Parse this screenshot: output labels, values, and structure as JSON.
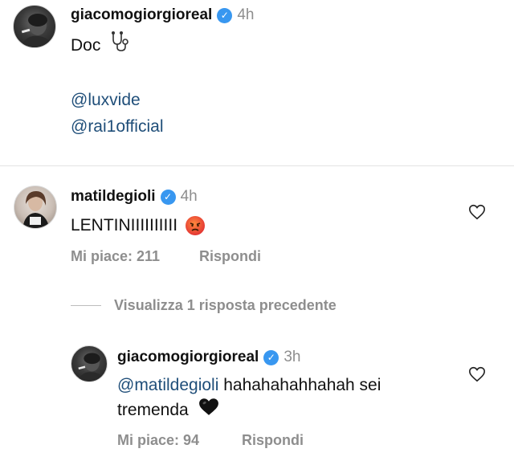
{
  "post": {
    "username": "giacomogiorgioreal",
    "time": "4h",
    "caption_line1": "Doc",
    "mention1": "@luxvide",
    "mention2": "@rai1official"
  },
  "comment": {
    "username": "matildegioli",
    "time": "4h",
    "text": "LENTINIIIIIIIIII",
    "likes_label": "Mi piace: 211",
    "reply_label": "Rispondi"
  },
  "view_replies": {
    "label": "Visualizza 1 risposta precedente"
  },
  "reply": {
    "username": "giacomogiorgioreal",
    "time": "3h",
    "mention": "@matildegioli",
    "text_rest": "hahahahahhahah sei",
    "text_line2": "tremenda",
    "likes_label": "Mi piace: 94",
    "reply_label": "Rispondi"
  },
  "icons": {
    "verified": "verified-badge-icon",
    "heart": "heart-outline-icon",
    "stethoscope": "stethoscope-icon",
    "angry": "angry-face-emoji",
    "black_heart": "black-heart-emoji"
  },
  "colors": {
    "verified": "#3897f0",
    "mention": "#1f4e79",
    "muted": "#8e8e8e"
  }
}
